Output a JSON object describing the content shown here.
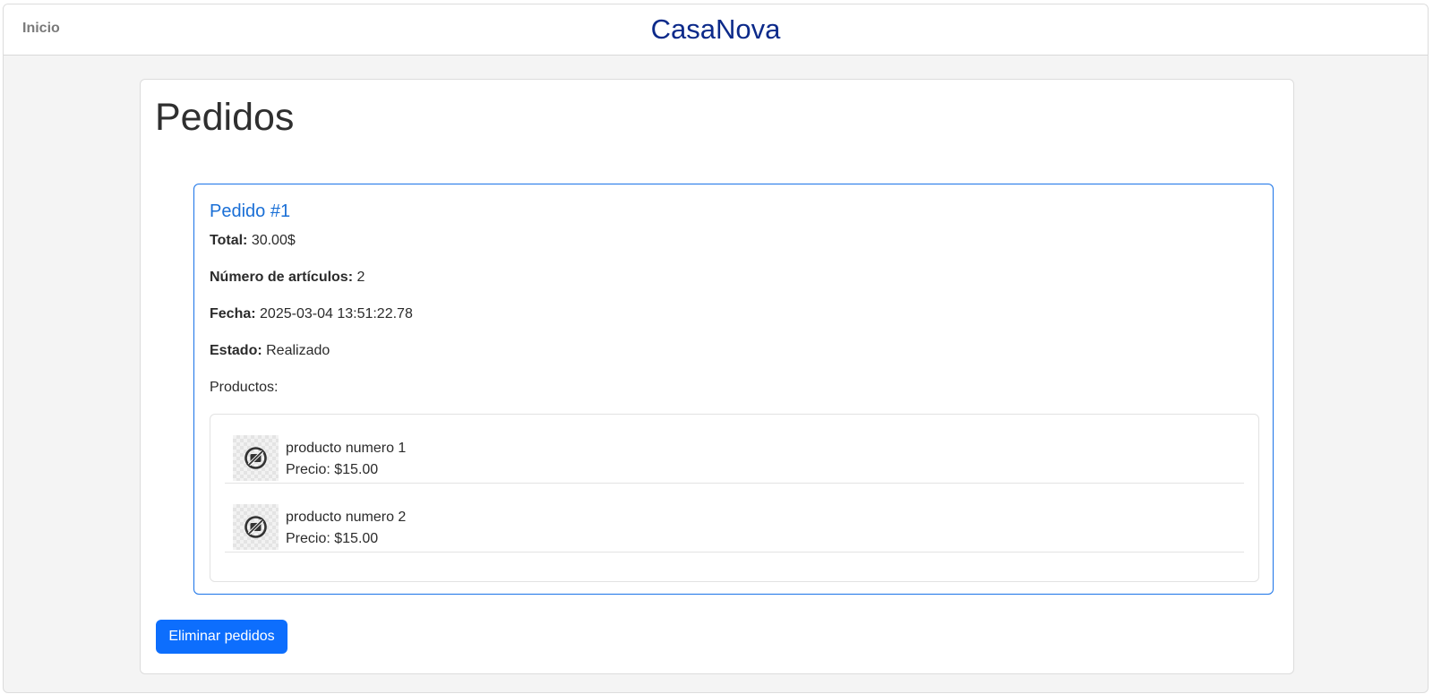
{
  "navbar": {
    "home_label": "Inicio",
    "brand": "CasaNova",
    "brand_color": "#0c2a8a"
  },
  "page": {
    "title": "Pedidos"
  },
  "order": {
    "title": "Pedido #1",
    "total_label": "Total:",
    "total_value": "30.00$",
    "items_label": "Número de artículos:",
    "items_value": "2",
    "date_label": "Fecha:",
    "date_value": "2025-03-04 13:51:22.78",
    "status_label": "Estado:",
    "status_value": "Realizado",
    "products_label": "Productos:",
    "products": [
      {
        "name": "producto numero 1",
        "price": "Precio: $15.00",
        "image_icon": "image-unavailable-icon"
      },
      {
        "name": "producto numero 2",
        "price": "Precio: $15.00",
        "image_icon": "image-unavailable-icon"
      }
    ]
  },
  "actions": {
    "delete_orders_label": "Eliminar pedidos",
    "accent_color": "#0d6efd"
  }
}
